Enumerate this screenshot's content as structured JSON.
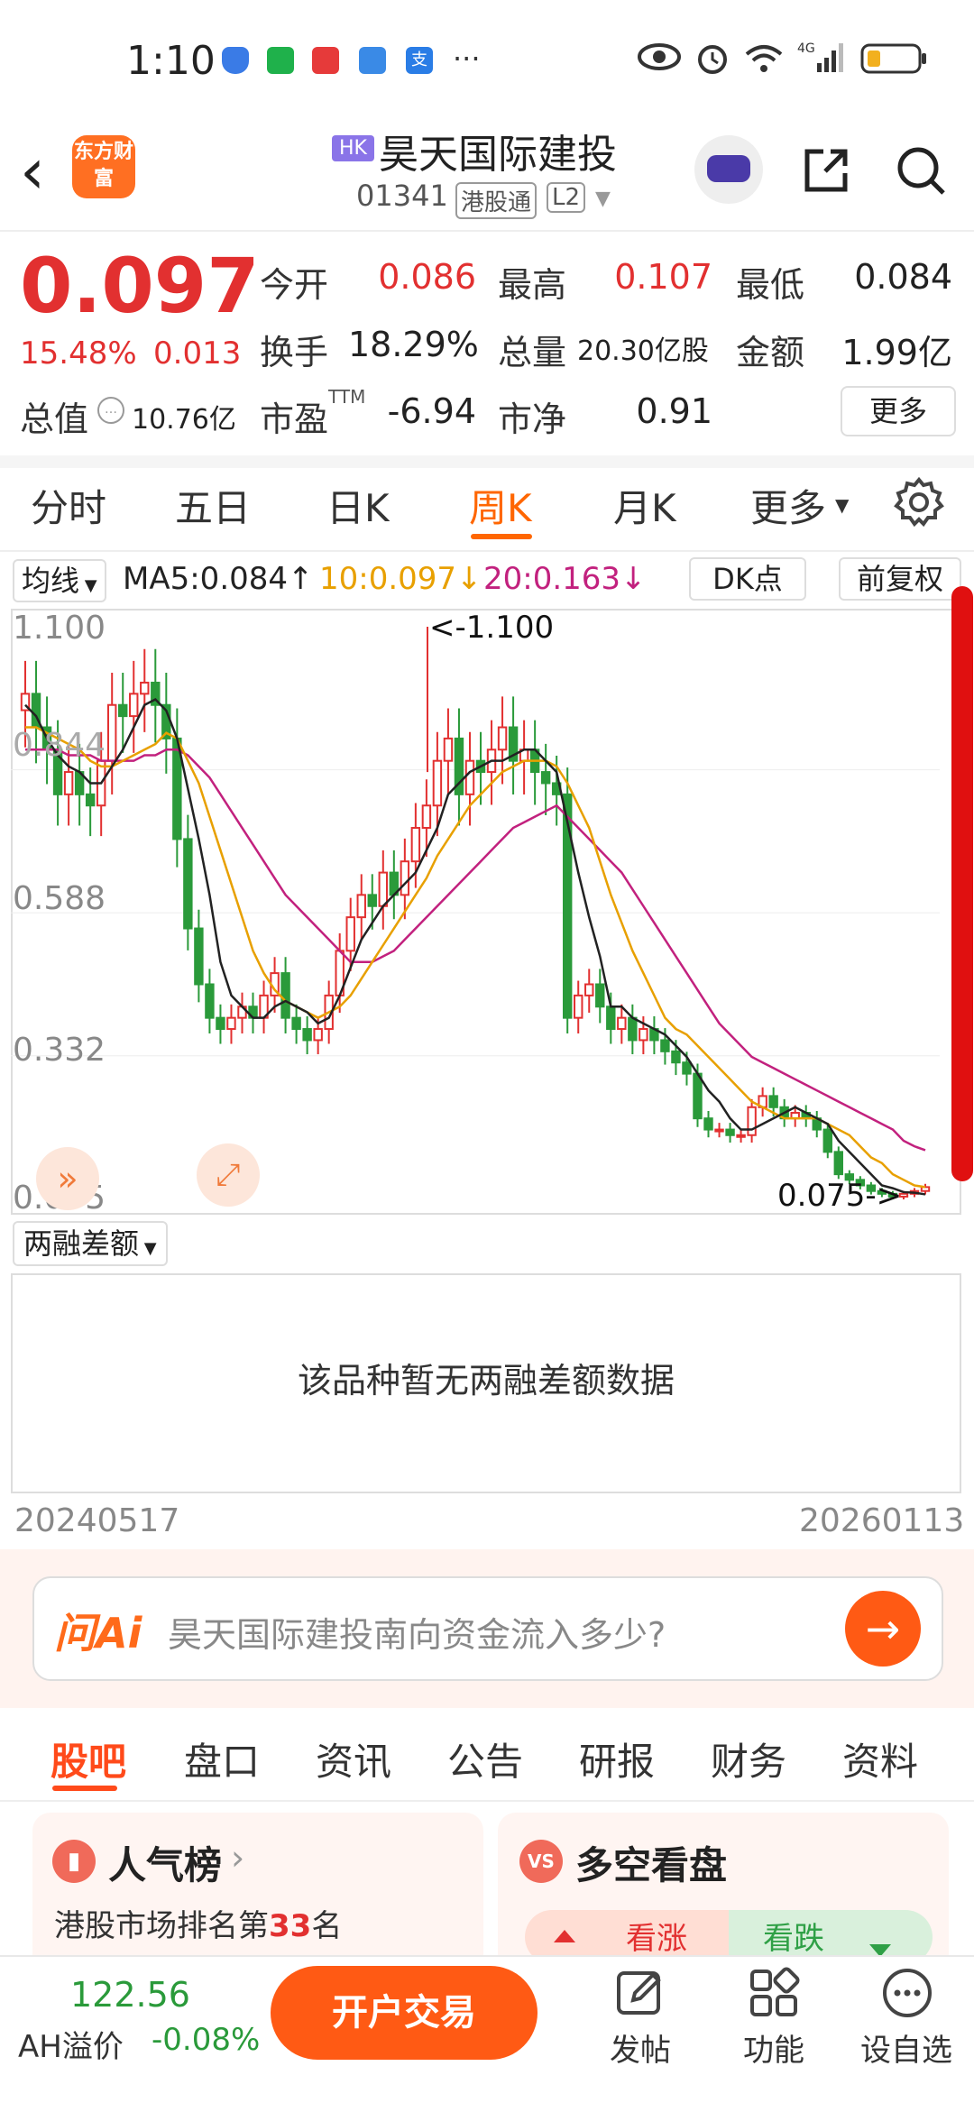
{
  "status_bar": {
    "time": "1:10",
    "dots": "···"
  },
  "header": {
    "back": "‹",
    "logo": "东方财富",
    "market_badge": "HK",
    "stock_name": "昊天国际建投",
    "stock_code": "01341",
    "tag_connect": "港股通",
    "tag_level": "L2"
  },
  "quote": {
    "price": "0.097",
    "change_pct": "15.48%",
    "change": "0.013",
    "open_label": "今开",
    "open": "0.086",
    "high_label": "最高",
    "high": "0.107",
    "low_label": "最低",
    "low": "0.084",
    "turnover_label": "换手",
    "turnover": "18.29%",
    "volume_label": "总量",
    "volume": "20.30亿股",
    "amount_label": "金额",
    "amount": "1.99亿",
    "mktcap_label": "总值",
    "mktcap": "10.76亿",
    "pe_label": "市盈",
    "pe_sup": "TTM",
    "pe": "-6.94",
    "pb_label": "市净",
    "pb": "0.91",
    "more": "更多"
  },
  "chart_tabs": [
    "分时",
    "五日",
    "日K",
    "周K",
    "月K",
    "更多"
  ],
  "active_chart_tab": "周K",
  "ma_row": {
    "selector": "均线",
    "ma5": "MA5:0.084↑",
    "ma10": "10:0.097↓",
    "ma20": "20:0.163↓",
    "dk": "DK点",
    "adjust": "前复权"
  },
  "chart_data": {
    "type": "candlestick",
    "y_ticks": [
      "1.100",
      "0.844",
      "0.588",
      "0.332",
      "0.075"
    ],
    "ylim": [
      0.075,
      1.1
    ],
    "max_marker": "<-1.100",
    "min_marker": "0.075->",
    "close": [
      0.98,
      0.92,
      0.88,
      0.8,
      0.84,
      0.8,
      0.78,
      0.86,
      0.96,
      0.94,
      0.98,
      1.0,
      0.96,
      0.9,
      0.72,
      0.56,
      0.46,
      0.4,
      0.38,
      0.4,
      0.42,
      0.4,
      0.44,
      0.48,
      0.4,
      0.38,
      0.36,
      0.38,
      0.44,
      0.52,
      0.58,
      0.62,
      0.6,
      0.66,
      0.62,
      0.68,
      0.74,
      0.78,
      0.86,
      0.9,
      0.8,
      0.86,
      0.84,
      0.88,
      0.92,
      0.86,
      0.88,
      0.84,
      0.82,
      0.8,
      0.4,
      0.44,
      0.46,
      0.42,
      0.38,
      0.4,
      0.36,
      0.38,
      0.36,
      0.34,
      0.32,
      0.3,
      0.22,
      0.2,
      0.2,
      0.19,
      0.19,
      0.24,
      0.26,
      0.24,
      0.22,
      0.23,
      0.22,
      0.2,
      0.16,
      0.12,
      0.11,
      0.1,
      0.09,
      0.085,
      0.08,
      0.085,
      0.09,
      0.097
    ],
    "ma5": [
      0.96,
      0.94,
      0.9,
      0.87,
      0.85,
      0.84,
      0.82,
      0.82,
      0.85,
      0.88,
      0.92,
      0.96,
      0.97,
      0.95,
      0.9,
      0.81,
      0.72,
      0.62,
      0.5,
      0.44,
      0.42,
      0.4,
      0.4,
      0.42,
      0.43,
      0.42,
      0.41,
      0.39,
      0.4,
      0.44,
      0.49,
      0.54,
      0.57,
      0.6,
      0.62,
      0.64,
      0.66,
      0.7,
      0.74,
      0.8,
      0.82,
      0.84,
      0.85,
      0.86,
      0.86,
      0.87,
      0.88,
      0.88,
      0.86,
      0.84,
      0.75,
      0.66,
      0.58,
      0.51,
      0.42,
      0.42,
      0.4,
      0.39,
      0.38,
      0.37,
      0.35,
      0.33,
      0.3,
      0.27,
      0.25,
      0.22,
      0.2,
      0.2,
      0.21,
      0.22,
      0.23,
      0.24,
      0.23,
      0.22,
      0.21,
      0.18,
      0.16,
      0.14,
      0.12,
      0.1,
      0.095,
      0.088,
      0.087,
      0.084
    ],
    "ma10": [
      0.92,
      0.92,
      0.91,
      0.9,
      0.89,
      0.88,
      0.86,
      0.85,
      0.85,
      0.86,
      0.87,
      0.88,
      0.89,
      0.91,
      0.9,
      0.86,
      0.82,
      0.76,
      0.7,
      0.64,
      0.58,
      0.52,
      0.48,
      0.45,
      0.43,
      0.42,
      0.41,
      0.4,
      0.41,
      0.42,
      0.44,
      0.47,
      0.5,
      0.53,
      0.56,
      0.59,
      0.62,
      0.65,
      0.69,
      0.72,
      0.75,
      0.78,
      0.8,
      0.82,
      0.84,
      0.85,
      0.86,
      0.86,
      0.86,
      0.85,
      0.82,
      0.78,
      0.74,
      0.68,
      0.62,
      0.57,
      0.52,
      0.48,
      0.44,
      0.4,
      0.38,
      0.37,
      0.35,
      0.33,
      0.31,
      0.29,
      0.27,
      0.25,
      0.24,
      0.23,
      0.22,
      0.22,
      0.22,
      0.22,
      0.21,
      0.2,
      0.19,
      0.17,
      0.15,
      0.14,
      0.12,
      0.11,
      0.1,
      0.097
    ],
    "ma20": [
      0.88,
      0.88,
      0.88,
      0.88,
      0.87,
      0.87,
      0.87,
      0.86,
      0.86,
      0.86,
      0.86,
      0.87,
      0.87,
      0.88,
      0.88,
      0.87,
      0.85,
      0.83,
      0.8,
      0.77,
      0.74,
      0.71,
      0.68,
      0.65,
      0.62,
      0.6,
      0.58,
      0.56,
      0.54,
      0.52,
      0.5,
      0.5,
      0.5,
      0.51,
      0.52,
      0.54,
      0.56,
      0.58,
      0.6,
      0.62,
      0.64,
      0.66,
      0.68,
      0.7,
      0.72,
      0.74,
      0.75,
      0.76,
      0.77,
      0.78,
      0.76,
      0.74,
      0.72,
      0.7,
      0.68,
      0.66,
      0.63,
      0.6,
      0.57,
      0.54,
      0.51,
      0.48,
      0.45,
      0.42,
      0.39,
      0.37,
      0.35,
      0.33,
      0.32,
      0.31,
      0.3,
      0.29,
      0.28,
      0.27,
      0.26,
      0.25,
      0.24,
      0.23,
      0.22,
      0.21,
      0.2,
      0.18,
      0.17,
      0.163
    ]
  },
  "margin": {
    "selector": "两融差额",
    "empty_msg": "该品种暂无两融差额数据",
    "date_start": "20240517",
    "date_end": "20260113"
  },
  "ai": {
    "logo": "问Ai",
    "prompt": "昊天国际建投南向资金流入多少?",
    "go": "→"
  },
  "bottom_tabs": [
    "股吧",
    "盘口",
    "资讯",
    "公告",
    "研报",
    "财务",
    "资料"
  ],
  "active_bottom_tab": "股吧",
  "cards": {
    "popular_title": "人气榜",
    "popular_sub_pre": "港股市场排名第",
    "popular_rank": "33",
    "popular_sub_post": "名",
    "vs_title": "多空看盘",
    "vs_icon": "VS",
    "rise": "看涨",
    "fall": "看跌"
  },
  "nav": {
    "ah_value": "122.56",
    "ah_label": "AH溢价",
    "ah_pct": "-0.08%",
    "trade": "开户交易",
    "post": "发帖",
    "func": "功能",
    "watch": "设自选"
  },
  "colors": {
    "accent": "#ff6600",
    "up": "#e23030",
    "down": "#2a9a3a",
    "ma5": "#222222",
    "ma10": "#e8a000",
    "ma20": "#c2217e"
  }
}
